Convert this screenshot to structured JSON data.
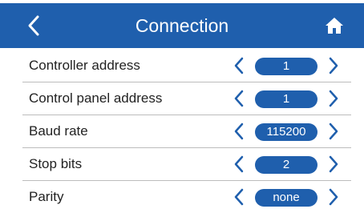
{
  "header": {
    "title": "Connection",
    "back_icon": "chevron-left-icon",
    "home_icon": "home-icon"
  },
  "colors": {
    "accent": "#1f5fad",
    "header_text": "#ffffff",
    "label_text": "#222222",
    "divider": "#bcbcbc"
  },
  "settings": [
    {
      "label": "Controller address",
      "value": "1"
    },
    {
      "label": "Control panel address",
      "value": "1"
    },
    {
      "label": "Baud rate",
      "value": "115200"
    },
    {
      "label": "Stop bits",
      "value": "2"
    },
    {
      "label": "Parity",
      "value": "none"
    }
  ]
}
